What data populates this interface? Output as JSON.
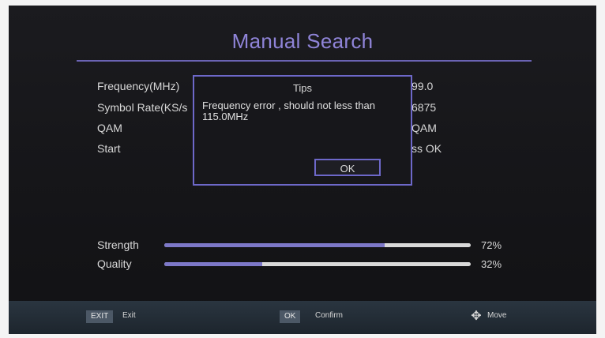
{
  "title": "Manual Search",
  "params": [
    {
      "label": "Frequency(MHz)",
      "value": "99.0"
    },
    {
      "label": "Symbol Rate(KS/s",
      "value": "6875"
    },
    {
      "label": "QAM",
      "value": "QAM"
    },
    {
      "label": "Start",
      "value": "ss OK"
    }
  ],
  "dialog": {
    "title": "Tips",
    "message": "Frequency error , should not less than 115.0MHz",
    "ok_label": "OK"
  },
  "meters": [
    {
      "label": "Strength",
      "value_text": "72%",
      "level": 0.72
    },
    {
      "label": "Quality",
      "value_text": "32%",
      "level": 0.32
    }
  ],
  "footer": {
    "exit_key": "EXIT",
    "exit_label": "Exit",
    "ok_key": "OK",
    "confirm_label": "Confirm",
    "move_icon": "move-arrows-icon",
    "move_label": "Move"
  },
  "colors": {
    "accent": "#7d78c8",
    "title": "#8f84d8"
  }
}
